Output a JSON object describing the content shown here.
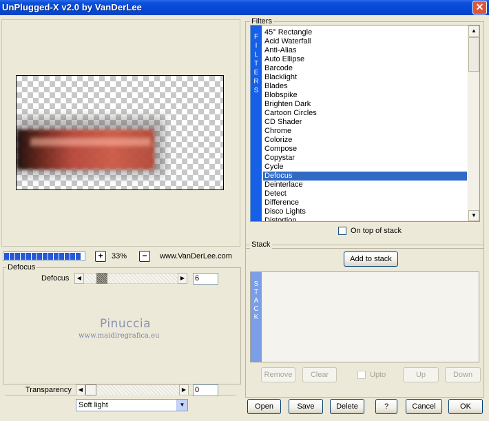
{
  "window": {
    "title": "UnPlugged-X v2.0 by VanDerLee",
    "close_glyph": "✕"
  },
  "zoom": {
    "minus": "−",
    "plus": "+",
    "value": "33%",
    "site": "www.VanDerLee.com",
    "progress_segments": 14
  },
  "filters": {
    "group_label": "Filters",
    "strip_letters": [
      "F",
      "I",
      "L",
      "T",
      "E",
      "R",
      "S"
    ],
    "items": [
      "45° Rectangle",
      "Acid Waterfall",
      "Anti-Alias",
      "Auto Ellipse",
      "Barcode",
      "Blacklight",
      "Blades",
      "Blobspike",
      "Brighten Dark",
      "Cartoon Circles",
      "CD Shader",
      "Chrome",
      "Colorize",
      "Compose",
      "Copystar",
      "Cycle",
      "Defocus",
      "Deinterlace",
      "Detect",
      "Difference",
      "Disco Lights",
      "Distortion"
    ],
    "selected_index": 16,
    "on_top_label": "On top of stack"
  },
  "stack": {
    "group_label": "Stack",
    "add_label": "Add to stack",
    "strip_letters": [
      "S",
      "T",
      "A",
      "C",
      "K"
    ],
    "remove_label": "Remove",
    "clear_label": "Clear",
    "upto_label": "Upto",
    "up_label": "Up",
    "down_label": "Down"
  },
  "defocus": {
    "group_label": "Defocus",
    "param_label": "Defocus",
    "value": "6"
  },
  "watermark": {
    "name": "Pinuccia",
    "url": "www.maidiregrafica.eu"
  },
  "transparency": {
    "label": "Transparency",
    "value": "0",
    "blend_mode": "Soft light"
  },
  "buttons": {
    "open": "Open",
    "save": "Save",
    "delete": "Delete",
    "help": "?",
    "cancel": "Cancel",
    "ok": "OK"
  },
  "colors": {
    "title_bar": "#0648d6",
    "selection": "#316ac5",
    "strip": "#1660e8",
    "close": "#e0543a"
  },
  "icons": {
    "arrow_left": "◀",
    "arrow_right": "▶",
    "arrow_up": "▲",
    "arrow_down": "▼"
  }
}
